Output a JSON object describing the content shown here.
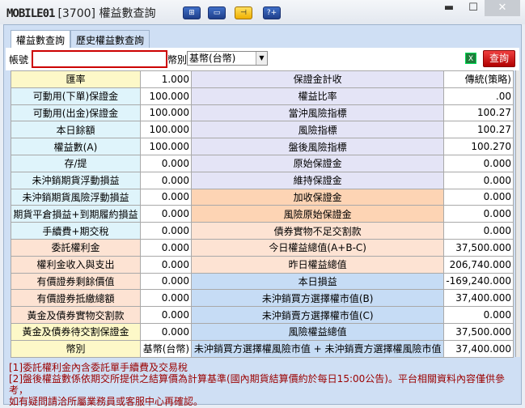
{
  "window": {
    "logo": "MOBILE01",
    "title": "[3700] 權益數查詢",
    "minimize": "▬",
    "maximize": "☐",
    "close": "✕"
  },
  "toolbar_buttons": [
    "⊞",
    "▭",
    "⊣",
    "?+"
  ],
  "tabs": [
    {
      "label": "權益數查詢",
      "active": true
    },
    {
      "label": "歷史權益數查詢",
      "active": false
    }
  ],
  "form": {
    "account_label": "帳號",
    "account_value": "",
    "currency_label": "幣別",
    "currency_value": "基幣(台幣)",
    "export_icon": "X",
    "query_label": "查詢"
  },
  "rows": [
    {
      "l1": "匯率",
      "v1": "1.000",
      "l2": "保證金計收",
      "v2": "傳統(策略)"
    },
    {
      "l1": "可動用(下單)保證金",
      "v1": "100.000",
      "l2": "權益比率",
      "v2": ".00"
    },
    {
      "l1": "可動用(出金)保證金",
      "v1": "100.000",
      "l2": "當沖風險指標",
      "v2": "100.27"
    },
    {
      "l1": "本日餘額",
      "v1": "100.000",
      "l2": "風險指標",
      "v2": "100.27"
    },
    {
      "l1": "權益數(A)",
      "v1": "100.000",
      "l2": "盤後風險指標",
      "v2": "100.270"
    },
    {
      "l1": "存/提",
      "v1": "0.000",
      "l2": "原始保證金",
      "v2": "0.000"
    },
    {
      "l1": "未沖銷期貨浮動損益",
      "v1": "0.000",
      "l2": "維持保證金",
      "v2": "0.000"
    },
    {
      "l1": "未沖銷期貨風險浮動損益",
      "v1": "0.000",
      "l2": "加收保證金",
      "v2": "0.000"
    },
    {
      "l1": "期貨平倉損益+到期履約損益",
      "v1": "0.000",
      "l2": "風險原始保證金",
      "v2": "0.000"
    },
    {
      "l1": "手續費+期交稅",
      "v1": "0.000",
      "l2": "債券實物不足交割款",
      "v2": "0.000"
    },
    {
      "l1": "委託權利金",
      "v1": "0.000",
      "l2": "今日權益總值(A+B-C)",
      "v2": "37,500.000"
    },
    {
      "l1": "權利金收入與支出",
      "v1": "0.000",
      "l2": "昨日權益總值",
      "v2": "206,740.000"
    },
    {
      "l1": "有價證券剩餘價值",
      "v1": "0.000",
      "l2": "本日損益",
      "v2": "-169,240.000"
    },
    {
      "l1": "有價證券抵繳總額",
      "v1": "0.000",
      "l2": "未沖銷買方選擇權市值(B)",
      "v2": "37,400.000"
    },
    {
      "l1": "黃金及債券實物交割款",
      "v1": "0.000",
      "l2": "未沖銷賣方選擇權市值(C)",
      "v2": "0.000"
    },
    {
      "l1": "黃金及債券待交割保證金",
      "v1": "0.000",
      "l2": "風險權益總值",
      "v2": "37,500.000"
    },
    {
      "l1": "幣別",
      "v1": "基幣(台幣)",
      "l2": "未沖銷買方選擇權風險市值 + 未沖銷賣方選擇權風險市值",
      "v2": "37,400.000"
    }
  ],
  "notes": [
    "[1]委託權利金內含委託單手續費及交易稅",
    "[2]盤後權益數係依期交所提供之結算價為計算基準(國內期貨結算價約於每日15:00公告)。平台相關資料內容僅供參考，",
    "如有疑問請洽所屬業務員或客服中心再確認。"
  ]
}
